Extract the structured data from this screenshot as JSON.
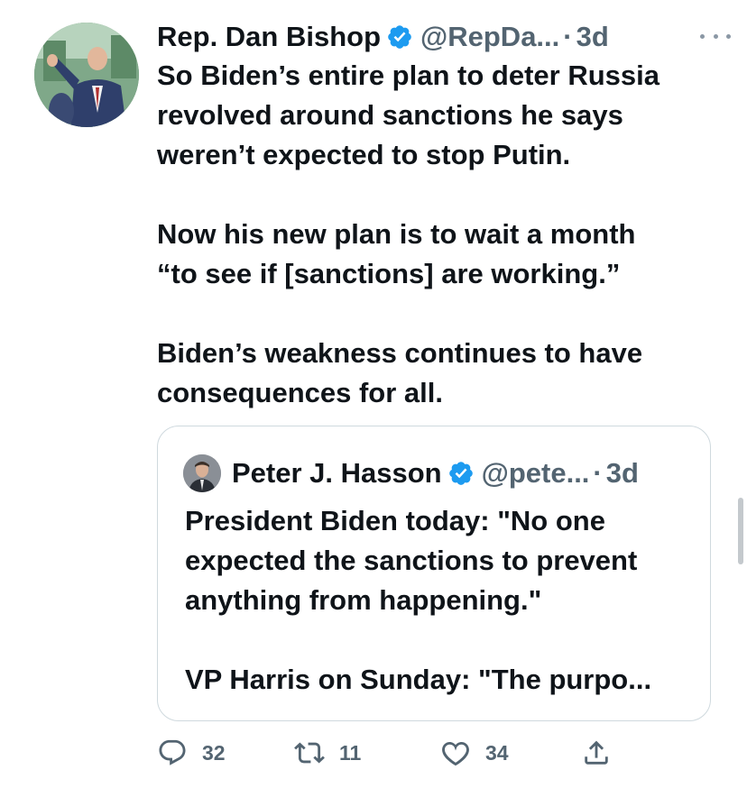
{
  "author": {
    "name": "Rep. Dan Bishop",
    "handle": "@RepDa...",
    "separator": "·",
    "time": "3d"
  },
  "tweet_body": [
    "So Biden’s entire plan to deter Russia",
    "revolved around sanctions he says",
    "weren’t expected to stop Putin.",
    "",
    "Now his new plan is to wait a month",
    "“to see if [sanctions] are working.”",
    "",
    "Biden’s weakness continues to have",
    "consequences for all."
  ],
  "quoted": {
    "name": "Peter J. Hasson",
    "handle": "@pete...",
    "separator": "·",
    "time": "3d",
    "body": [
      "President Biden today: \"No one",
      "expected the sanctions to prevent",
      "anything from happening.\"",
      "",
      "VP Harris on Sunday: \"The purpo..."
    ]
  },
  "actions": {
    "reply_count": "32",
    "retweet_count": "11",
    "like_count": "34"
  },
  "icons": {
    "verified": "verified-badge-icon",
    "more": "more-icon",
    "reply": "reply-icon",
    "retweet": "retweet-icon",
    "like": "heart-icon",
    "share": "share-icon"
  },
  "colors": {
    "verified": "#1d9bf0",
    "secondary_text": "#536471",
    "border": "#cfd9de"
  }
}
